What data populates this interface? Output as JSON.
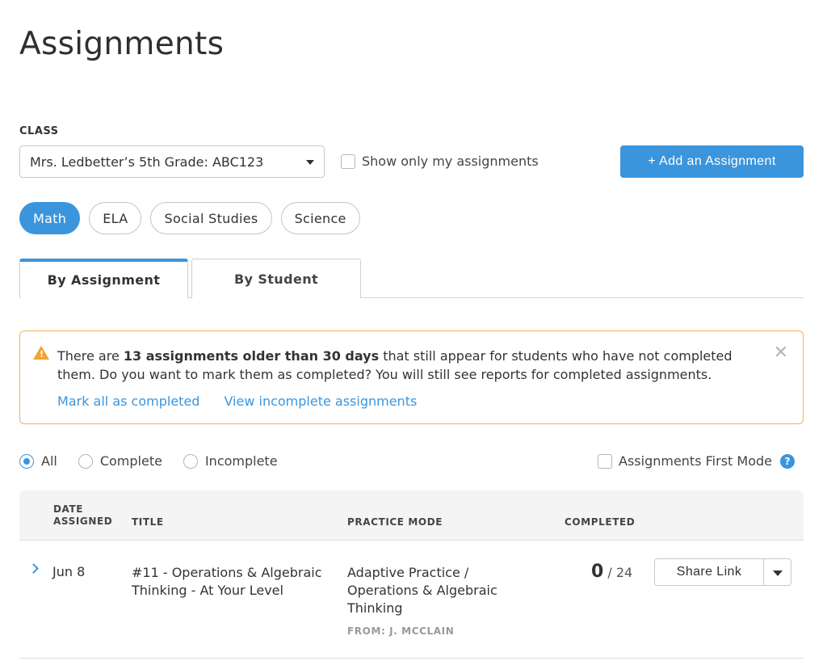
{
  "page": {
    "title": "Assignments"
  },
  "class": {
    "label": "CLASS",
    "selected": "Mrs. Ledbetter’s 5th Grade: ABC123",
    "only_mine_label": "Show only my assignments"
  },
  "toolbar": {
    "add_label": "+ Add an Assignment"
  },
  "subjects": [
    {
      "label": "Math",
      "active": true
    },
    {
      "label": "ELA",
      "active": false
    },
    {
      "label": "Social Studies",
      "active": false
    },
    {
      "label": "Science",
      "active": false
    }
  ],
  "tabs": [
    {
      "label": "By Assignment",
      "active": true
    },
    {
      "label": "By Student",
      "active": false
    }
  ],
  "alert": {
    "text_before": "There are ",
    "text_bold": "13 assignments older than 30 days",
    "text_after": " that still appear for students who have not completed them. Do you want to mark them as completed? You will still see reports for completed assignments.",
    "close_glyph": "✕",
    "warn_glyph": "!",
    "link_mark": "Mark all as completed",
    "link_view": "View incomplete assignments"
  },
  "filters": {
    "options": [
      {
        "label": "All",
        "checked": true
      },
      {
        "label": "Complete",
        "checked": false
      },
      {
        "label": "Incomplete",
        "checked": false
      }
    ],
    "first_mode_label": "Assignments First Mode",
    "help_glyph": "?"
  },
  "table": {
    "headers": {
      "date_line1": "DATE",
      "date_line2": "ASSIGNED",
      "title": "TITLE",
      "practice_mode": "PRACTICE MODE",
      "completed": "COMPLETED"
    },
    "rows": [
      {
        "date": "Jun 8",
        "title_line1": "#11 - Operations & Algebraic",
        "title_line2": "Thinking - At Your Level",
        "mode_line1": "Adaptive Practice /",
        "mode_line2": "Operations & Algebraic",
        "mode_line3": "Thinking",
        "from": "FROM: J. MCCLAIN",
        "completed": "0",
        "total": " / 24",
        "share_label": "Share Link"
      }
    ]
  },
  "colors": {
    "accent": "#3b95dc",
    "warning": "#f2b25e"
  }
}
